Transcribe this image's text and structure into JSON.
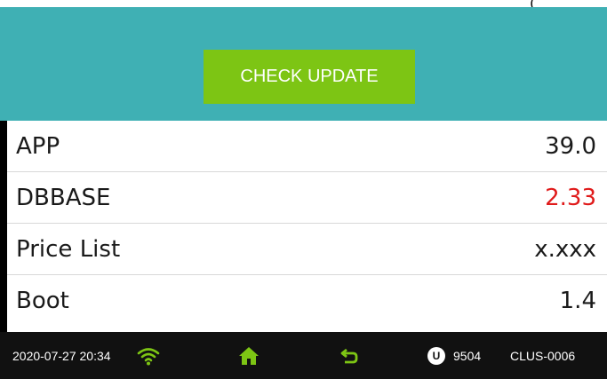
{
  "header": {
    "check_update_label": "CHECK UPDATE"
  },
  "versions": [
    {
      "label": "APP",
      "value": "39.0"
    },
    {
      "label": "DBBASE",
      "value": "2.33",
      "value_color": "#e01b1b"
    },
    {
      "label": "Price List",
      "value": "x.xxx"
    },
    {
      "label": "Boot",
      "value": "1.4"
    }
  ],
  "status_bar": {
    "datetime": "2020-07-27 20:34",
    "user_badge": "U",
    "user_id": "9504",
    "device_id": "CLUS-0006",
    "icons": [
      "wifi-icon",
      "home-icon",
      "back-icon"
    ]
  },
  "colors": {
    "header_bg": "#3fb0b4",
    "button_bg": "#7dc514",
    "footer_bg": "#111111",
    "icon_green": "#7dc514",
    "highlight_red": "#e01b1b"
  }
}
